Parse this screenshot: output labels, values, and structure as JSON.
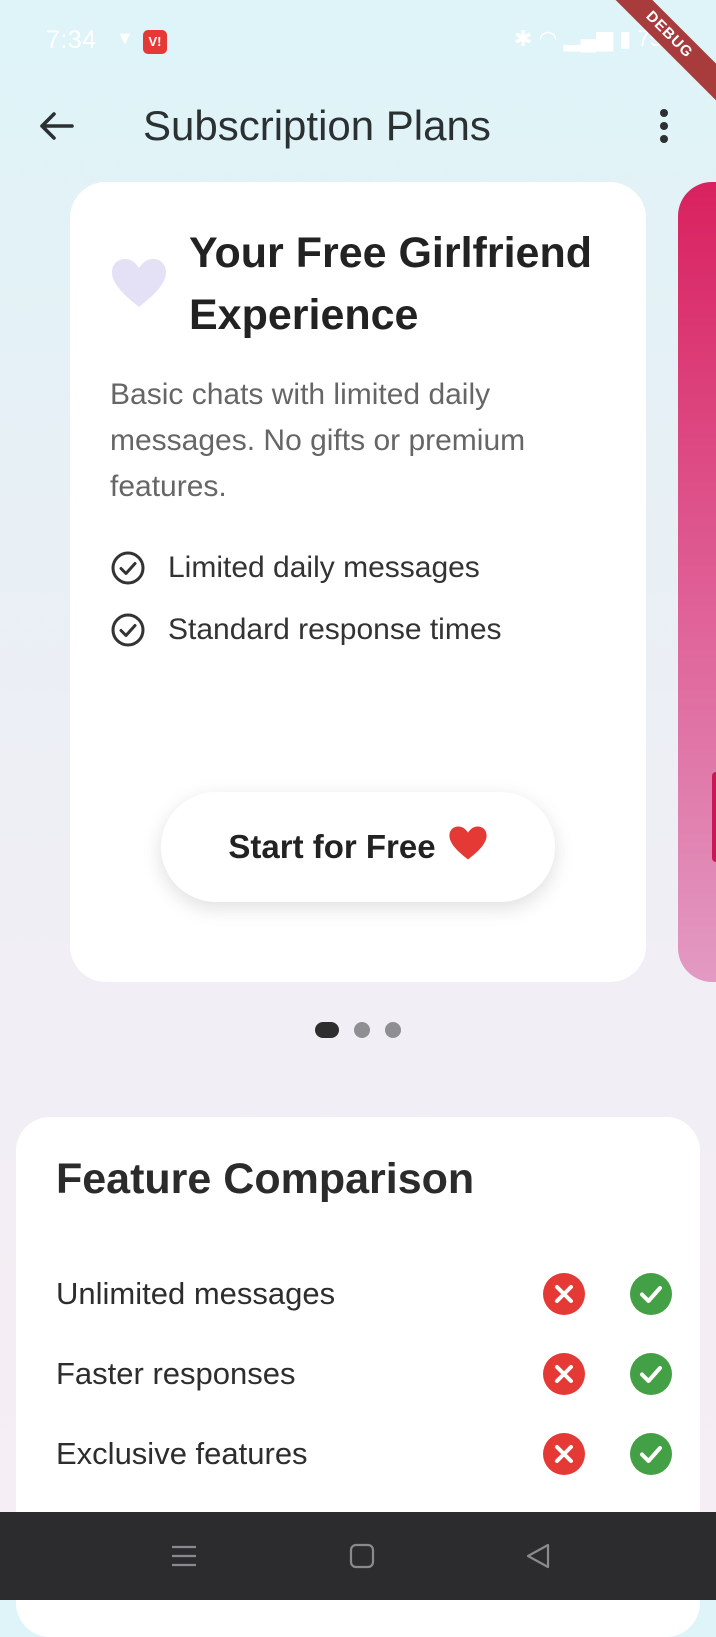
{
  "status_bar": {
    "time": "7:34",
    "carrier_badge": "V!",
    "battery": "75",
    "debug_label": "DEBUG"
  },
  "app_bar": {
    "title": "Subscription Plans"
  },
  "plan_card": {
    "icon": "heart-icon",
    "title": "Your Free Girlfriend Experience",
    "description": "Basic chats with limited daily messages. No gifts or premium features.",
    "features": [
      "Limited daily messages",
      "Standard response times"
    ],
    "cta_label": "Start for Free",
    "cta_emoji": "❤️"
  },
  "carousel": {
    "page_count": 3,
    "active_index": 0
  },
  "comparison": {
    "title": "Feature Comparison",
    "rows": [
      {
        "label": "Unlimited messages",
        "free": false,
        "premium": true
      },
      {
        "label": "Faster responses",
        "free": false,
        "premium": true
      },
      {
        "label": "Exclusive features",
        "free": false,
        "premium": true
      }
    ]
  },
  "colors": {
    "accent_pink": "#d9215f",
    "heart_lavender": "#e4e1f7",
    "no_red": "#e53935",
    "yes_green": "#43a047"
  }
}
